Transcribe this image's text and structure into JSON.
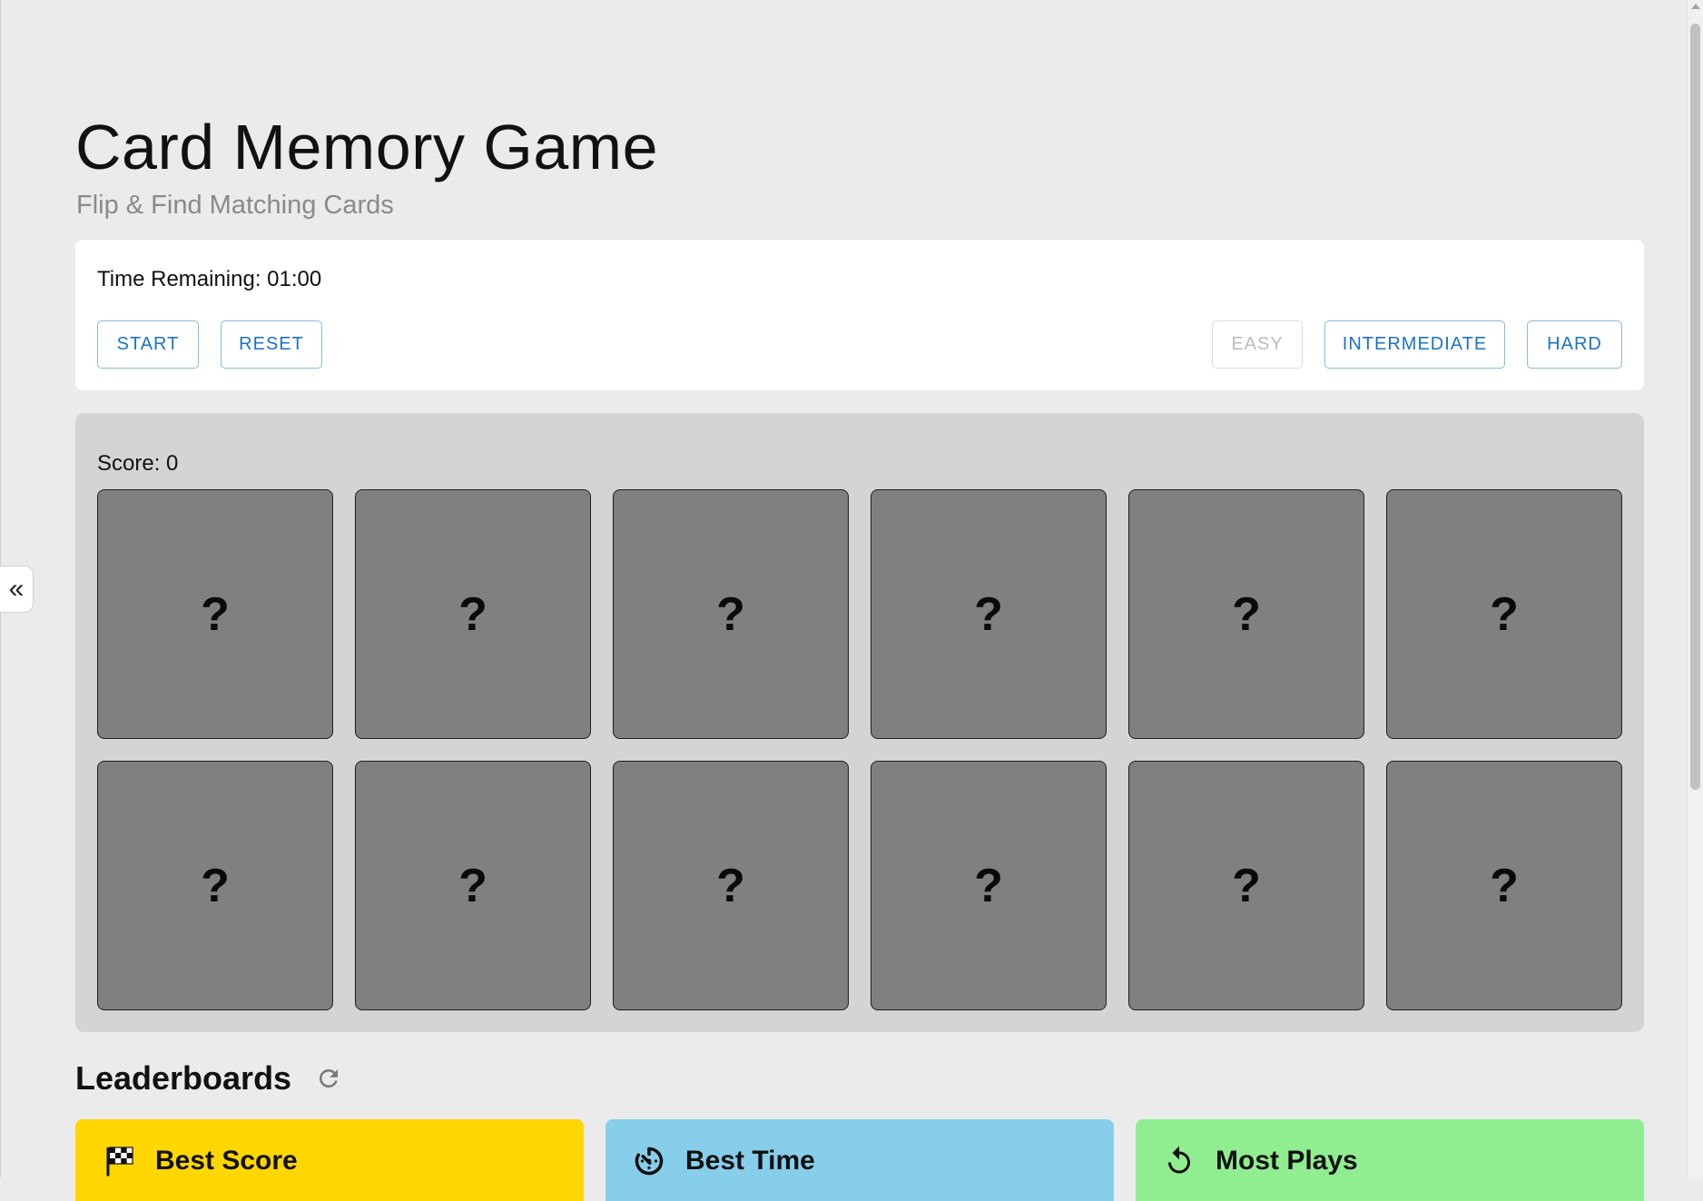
{
  "header": {
    "title": "Card Memory Game",
    "subtitle": "Flip & Find Matching Cards"
  },
  "controls": {
    "time_remaining": "Time Remaining: 01:00",
    "start_label": "START",
    "reset_label": "RESET",
    "difficulty": [
      {
        "label": "EASY",
        "disabled": true
      },
      {
        "label": "INTERMEDIATE",
        "disabled": false
      },
      {
        "label": "HARD",
        "disabled": false
      }
    ]
  },
  "board": {
    "score": "Score: 0",
    "cards": [
      "?",
      "?",
      "?",
      "?",
      "?",
      "?",
      "?",
      "?",
      "?",
      "?",
      "?",
      "?"
    ]
  },
  "leaderboards": {
    "title": "Leaderboards",
    "cards": [
      {
        "label": "Best Score",
        "icon": "checkered-flag-icon",
        "color": "#ffd700"
      },
      {
        "label": "Best Time",
        "icon": "timer-icon",
        "color": "#87ceeb"
      },
      {
        "label": "Most Plays",
        "icon": "replay-icon",
        "color": "#90ee90"
      }
    ]
  },
  "sidebar_toggle": {
    "icon": "double-chevron-left-icon",
    "glyph": "«"
  },
  "theme": {
    "background": "#ebebeb",
    "accent": "#1a73c9",
    "card_back": "#808080"
  }
}
